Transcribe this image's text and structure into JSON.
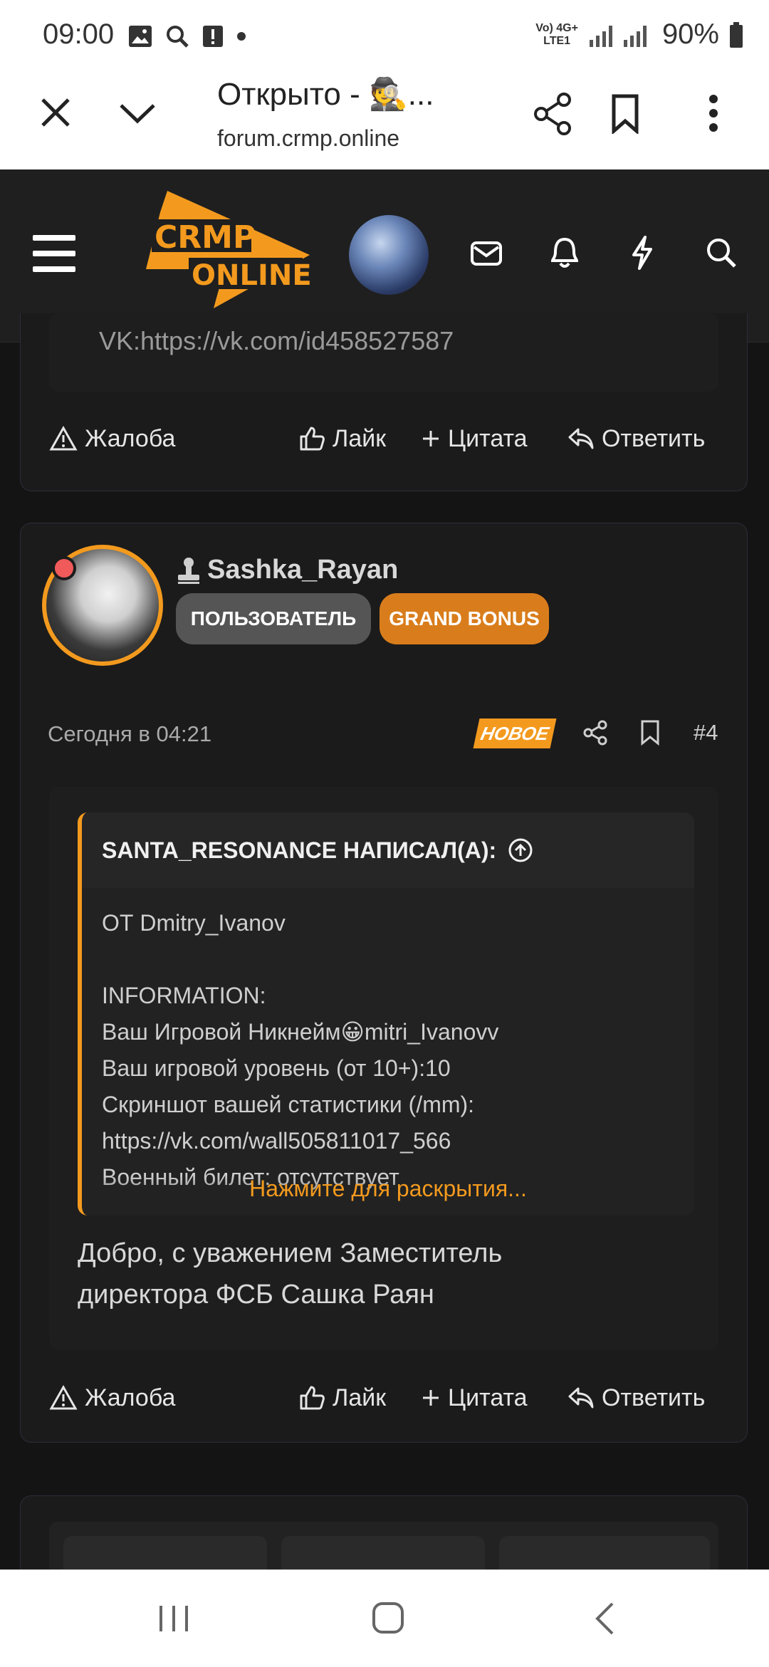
{
  "status": {
    "time": "09:00",
    "net_top": "Vo) 4G+",
    "net_bottom": "LTE1",
    "battery": "90%"
  },
  "browser": {
    "title": "Открыто - 🕵️...",
    "url": "forum.crmp.online"
  },
  "site": {
    "logo_line1": "CRMP",
    "logo_line2": "ONLINE"
  },
  "post1": {
    "sig": "VK:https://vk.com/id458527587",
    "actions": {
      "report": "Жалоба",
      "like": "Лайк",
      "quote": "Цитата",
      "reply": "Ответить"
    }
  },
  "post2": {
    "username": "Sashka_Rayan",
    "badge_user": "ПОЛЬЗОВАТЕЛЬ",
    "badge_bonus": "GRAND BONUS",
    "date": "Сегодня в 04:21",
    "new_label": "НОВОЕ",
    "number": "#4",
    "quote": {
      "author": "SANTA_RESONANCE НАПИСАЛ(А):",
      "lines": [
        "ОТ Dmitry_Ivanov",
        "",
        "INFORMATION:",
        "Ваш Игровой Никнейм😀mitri_Ivanovv",
        "Ваш игровой уровень (от 10+):10",
        "Скриншот вашей статистики (/mm):",
        "https://vk.com/wall505811017_566",
        "Военный билет: отсутствует"
      ],
      "expand": "Нажмите для раскрытия..."
    },
    "body_line1": "Добро, с уважением Заместитель",
    "body_line2": "директора ФСБ Сашка Раян",
    "actions": {
      "report": "Жалоба",
      "like": "Лайк",
      "quote": "Цитата",
      "reply": "Ответить"
    }
  },
  "colors": {
    "accent": "#f39a1e",
    "badge_user": "#555555",
    "background": "#141414"
  }
}
